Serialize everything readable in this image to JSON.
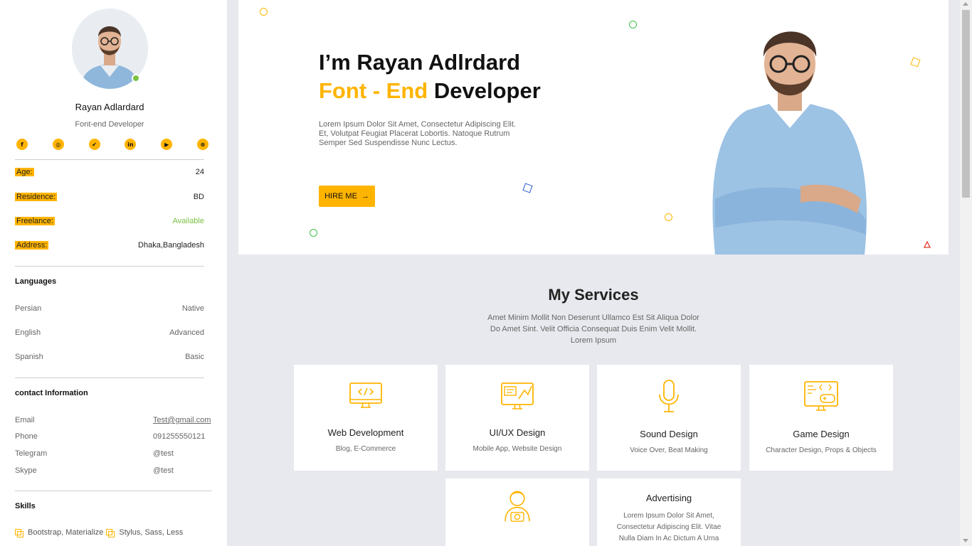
{
  "profile": {
    "name": "Rayan Adlardard",
    "role": "Font-end Developer",
    "status_color": "#7ac143",
    "socials": [
      {
        "icon": "facebook-icon",
        "glyph": "f"
      },
      {
        "icon": "instagram-icon",
        "glyph": "◎"
      },
      {
        "icon": "twitter-icon",
        "glyph": "✔"
      },
      {
        "icon": "linkedin-icon",
        "glyph": "in"
      },
      {
        "icon": "youtube-icon",
        "glyph": "▶"
      },
      {
        "icon": "dribbble-icon",
        "glyph": "⊛"
      }
    ]
  },
  "info": [
    {
      "key": "Age:",
      "value": "24"
    },
    {
      "key": "Residence:",
      "value": "BD"
    },
    {
      "key": "Freelance:",
      "value": "Available"
    },
    {
      "key": "Address:",
      "value": "Dhaka,Bangladesh"
    }
  ],
  "languages": {
    "heading": "Languages",
    "items": [
      {
        "name": "Persian",
        "level": "Native"
      },
      {
        "name": "English",
        "level": "Advanced"
      },
      {
        "name": "Spanish",
        "level": "Basic"
      }
    ]
  },
  "contact": {
    "heading": "contact Information",
    "items": [
      {
        "key": "Email",
        "value": "Test@gmail.com"
      },
      {
        "key": "Phone",
        "value": "091255550121"
      },
      {
        "key": "Telegram",
        "value": "@test"
      },
      {
        "key": "Skype",
        "value": "@test"
      }
    ]
  },
  "skills": {
    "heading": "Skills",
    "items": [
      "Bootstrap, Materialize",
      "Stylus, Sass, Less"
    ]
  },
  "hero": {
    "title_line1": "I’m Rayan Adlrdard",
    "title_accent": "Font - End",
    "title_rest": "Developer",
    "text": "Lorem Ipsum Dolor Sit Amet, Consectetur Adipiscing Elit. Et, Volutpat Feugiat Placerat Lobortis. Natoque Rutrum Semper Sed Suspendisse Nunc Lectus.",
    "button": "HIRE ME",
    "button_arrow": "→"
  },
  "services": {
    "title": "My Services",
    "subtitle": "Amet Minim Mollit Non Deserunt Ullamco Est Sit Aliqua Dolor Do Amet Sint. Velit Officia Consequat Duis Enim Velit Mollit. Lorem Ipsum",
    "cards": [
      {
        "icon": "monitor-code-icon",
        "title": "Web Development",
        "subtitle": "Blog, E-Commerce"
      },
      {
        "icon": "design-monitor-icon",
        "title": "UI/UX Design",
        "subtitle": "Mobile App, Website Design"
      },
      {
        "icon": "microphone-icon",
        "title": "Sound Design",
        "subtitle": "Voice Over, Beat Making"
      },
      {
        "icon": "game-monitor-icon",
        "title": "Game Design",
        "subtitle": "Character Design, Props & Objects"
      },
      {
        "icon": "photographer-icon",
        "title": "",
        "subtitle": ""
      },
      {
        "icon": "",
        "title": "Advertising",
        "subtitle": "Lorem Ipsum Dolor Sit Amet, Consectetur Adipiscing Elit. Vitae Nulla Diam In Ac Dictum A Urna"
      }
    ]
  },
  "colors": {
    "accent": "#ffb400",
    "green": "#7ac143",
    "background": "#e8e9ee"
  }
}
